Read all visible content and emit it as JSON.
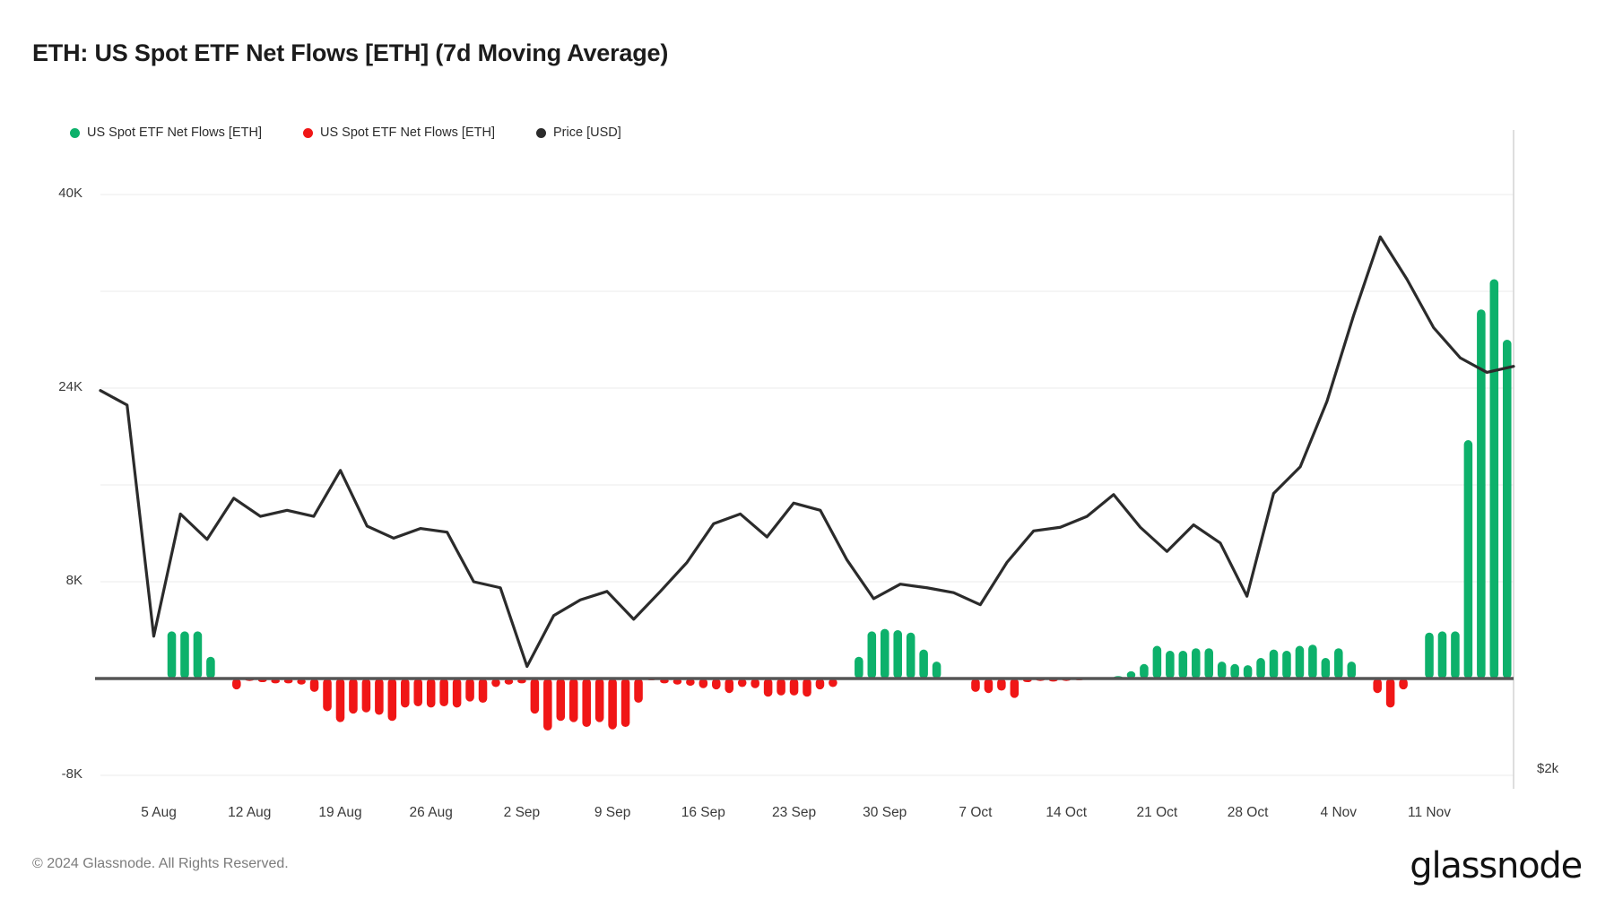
{
  "header": {
    "title": "ETH: US Spot ETF Net Flows [ETH] (7d Moving Average)"
  },
  "legend": {
    "items": [
      {
        "label": "US Spot ETF Net Flows [ETH]",
        "color": "#0DB16B",
        "icon": "legend-dot-green"
      },
      {
        "label": "US Spot ETF Net Flows [ETH]",
        "color": "#F01616",
        "icon": "legend-dot-red"
      },
      {
        "label": "Price [USD]",
        "color": "#2B2B2B",
        "icon": "legend-dot-black"
      }
    ]
  },
  "footer": {
    "copyright": "© 2024 Glassnode. All Rights Reserved.",
    "brand": "glassnode"
  },
  "axes": {
    "y_left_ticks": [
      "40K",
      "24K",
      "8K",
      "-8K"
    ],
    "y_right_label": "$2k",
    "x_ticks": [
      "5 Aug",
      "12 Aug",
      "19 Aug",
      "26 Aug",
      "2 Sep",
      "9 Sep",
      "16 Sep",
      "23 Sep",
      "30 Sep",
      "7 Oct",
      "14 Oct",
      "21 Oct",
      "28 Oct",
      "4 Nov",
      "11 Nov"
    ]
  },
  "chart_data": {
    "type": "bar",
    "title": "ETH: US Spot ETF Net Flows [ETH] (7d Moving Average)",
    "xlabel": "",
    "ylabel": "",
    "ylim": [
      -8000,
      44000
    ],
    "grid": true,
    "legend_position": "top-left",
    "colors": {
      "positive": "#0DB16B",
      "negative": "#F01616",
      "price_line": "#2B2B2B",
      "zero_line": "#555555",
      "gridline": "#F2F2F2",
      "text": "#3A3A3A"
    },
    "y_axis_left": {
      "ticks": [
        -8000,
        8000,
        24000,
        40000
      ],
      "tick_labels": [
        "-8K",
        "8K",
        "24K",
        "40K"
      ],
      "unit": "ETH"
    },
    "y_axis_right": {
      "label": "$2k",
      "unit": "USD"
    },
    "x_axis": {
      "tick_labels": [
        "5 Aug",
        "12 Aug",
        "19 Aug",
        "26 Aug",
        "2 Sep",
        "9 Sep",
        "16 Sep",
        "23 Sep",
        "30 Sep",
        "7 Oct",
        "14 Oct",
        "21 Oct",
        "28 Oct",
        "4 Nov",
        "11 Nov"
      ],
      "start": "2024-08-01",
      "end": "2024-11-14"
    },
    "series": [
      {
        "name": "US Spot ETF Net Flows [ETH]",
        "type": "bar",
        "unit": "ETH",
        "dates": [
          "1 Aug",
          "2 Aug",
          "3 Aug",
          "4 Aug",
          "5 Aug",
          "6 Aug",
          "7 Aug",
          "8 Aug",
          "9 Aug",
          "10 Aug",
          "11 Aug",
          "12 Aug",
          "13 Aug",
          "14 Aug",
          "15 Aug",
          "16 Aug",
          "17 Aug",
          "18 Aug",
          "19 Aug",
          "20 Aug",
          "21 Aug",
          "22 Aug",
          "23 Aug",
          "24 Aug",
          "25 Aug",
          "26 Aug",
          "27 Aug",
          "28 Aug",
          "29 Aug",
          "30 Aug",
          "31 Aug",
          "1 Sep",
          "2 Sep",
          "3 Sep",
          "4 Sep",
          "5 Sep",
          "6 Sep",
          "7 Sep",
          "8 Sep",
          "9 Sep",
          "10 Sep",
          "11 Sep",
          "12 Sep",
          "13 Sep",
          "14 Sep",
          "15 Sep",
          "16 Sep",
          "17 Sep",
          "18 Sep",
          "19 Sep",
          "20 Sep",
          "21 Sep",
          "22 Sep",
          "23 Sep",
          "24 Sep",
          "25 Sep",
          "26 Sep",
          "27 Sep",
          "28 Sep",
          "29 Sep",
          "30 Sep",
          "1 Oct",
          "2 Oct",
          "3 Oct",
          "4 Oct",
          "5 Oct",
          "6 Oct",
          "7 Oct",
          "8 Oct",
          "9 Oct",
          "10 Oct",
          "11 Oct",
          "12 Oct",
          "13 Oct",
          "14 Oct",
          "15 Oct",
          "16 Oct",
          "17 Oct",
          "18 Oct",
          "19 Oct",
          "20 Oct",
          "21 Oct",
          "22 Oct",
          "23 Oct",
          "24 Oct",
          "25 Oct",
          "26 Oct",
          "27 Oct",
          "28 Oct",
          "29 Oct",
          "30 Oct",
          "31 Oct",
          "1 Nov",
          "2 Nov",
          "3 Nov",
          "4 Nov",
          "5 Nov",
          "6 Nov",
          "7 Nov",
          "8 Nov",
          "9 Nov",
          "10 Nov",
          "11 Nov",
          "12 Nov",
          "13 Nov",
          "14 Nov"
        ],
        "values": [
          0,
          0,
          0,
          0,
          0,
          3900,
          3900,
          3900,
          1800,
          0,
          -900,
          -200,
          -300,
          -400,
          -400,
          -500,
          -1100,
          -2700,
          -3600,
          -2900,
          -2800,
          -3000,
          -3500,
          -2400,
          -2300,
          -2400,
          -2300,
          -2400,
          -1900,
          -2000,
          -700,
          -500,
          -400,
          -2900,
          -4300,
          -3500,
          -3600,
          -4000,
          -3600,
          -4200,
          -4000,
          -2000,
          -150,
          -400,
          -500,
          -600,
          -800,
          -900,
          -1200,
          -700,
          -800,
          -1500,
          -1400,
          -1400,
          -1500,
          -900,
          -700,
          0,
          1800,
          3900,
          4100,
          4000,
          3800,
          2400,
          1400,
          0,
          0,
          -1100,
          -1200,
          -1000,
          -1600,
          -300,
          -200,
          -250,
          -200,
          -150,
          -100,
          0,
          200,
          600,
          1200,
          2700,
          2300,
          2300,
          2500,
          2500,
          1400,
          1200,
          1100,
          1700,
          2400,
          2300,
          2700,
          2800,
          1700,
          2500,
          1400,
          0,
          -1200,
          -2400,
          -900,
          0,
          3800,
          3900,
          3900,
          19700,
          30500,
          33000,
          28000
        ],
        "bar_count": 107
      },
      {
        "name": "Price [USD]",
        "type": "line",
        "unit": "USD",
        "note": "Right axis, labelled $2k",
        "dates": [
          "1 Aug",
          "3 Aug",
          "5 Aug",
          "7 Aug",
          "9 Aug",
          "11 Aug",
          "13 Aug",
          "15 Aug",
          "17 Aug",
          "19 Aug",
          "21 Aug",
          "23 Aug",
          "25 Aug",
          "27 Aug",
          "29 Aug",
          "31 Aug",
          "2 Sep",
          "4 Sep",
          "6 Sep",
          "8 Sep",
          "10 Sep",
          "12 Sep",
          "14 Sep",
          "16 Sep",
          "18 Sep",
          "20 Sep",
          "22 Sep",
          "24 Sep",
          "26 Sep",
          "28 Sep",
          "30 Sep",
          "2 Oct",
          "4 Oct",
          "6 Oct",
          "8 Oct",
          "10 Oct",
          "12 Oct",
          "14 Oct",
          "16 Oct",
          "18 Oct",
          "20 Oct",
          "22 Oct",
          "24 Oct",
          "26 Oct",
          "28 Oct",
          "30 Oct",
          "1 Nov",
          "3 Nov",
          "5 Nov",
          "7 Nov",
          "9 Nov",
          "11 Nov",
          "13 Nov",
          "14 Nov"
        ],
        "values_eth_axis": [
          23800,
          22600,
          3500,
          13600,
          11500,
          14900,
          13400,
          13900,
          13400,
          17200,
          12600,
          11600,
          12400,
          12100,
          8000,
          7500,
          1000,
          5200,
          6500,
          7200,
          4900,
          7200,
          9600,
          12800,
          13600,
          11700,
          14500,
          13900,
          9800,
          6600,
          7800,
          7500,
          7100,
          6100,
          9600,
          12200,
          12500,
          13400,
          15200,
          12500,
          10500,
          12700,
          11200,
          6800,
          15300,
          17500,
          22900,
          30000,
          36500,
          33000,
          29000,
          26500,
          25300,
          25800
        ]
      }
    ]
  }
}
